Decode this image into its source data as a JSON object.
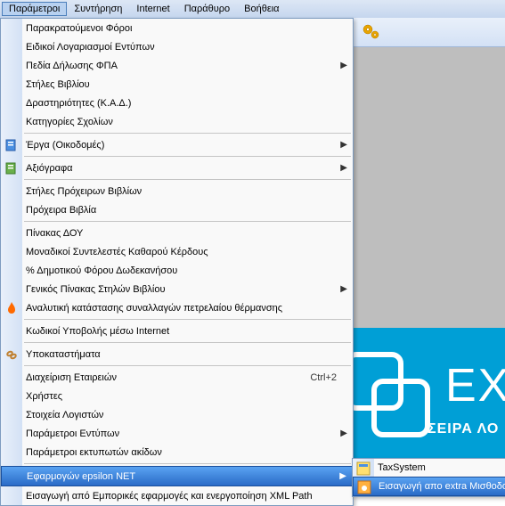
{
  "menubar": {
    "items": [
      "Παράμετροι",
      "Συντήρηση",
      "Internet",
      "Παράθυρο",
      "Βοήθεια"
    ],
    "active_index": 0
  },
  "brand": {
    "title": "EX",
    "subtitle": "ΣΕΙΡΑ ΛΟ"
  },
  "menu": {
    "groups": [
      [
        {
          "label": "Παρακρατούμενοι Φόροι"
        },
        {
          "label": "Ειδικοί Λογαριασμοί Εντύπων"
        },
        {
          "label": "Πεδία Δήλωσης ΦΠΑ",
          "sub": true
        },
        {
          "label": "Στήλες Βιβλίου"
        },
        {
          "label": "Δραστηριότητες (Κ.Α.Δ.)"
        },
        {
          "label": "Κατηγορίες Σχολίων"
        }
      ],
      [
        {
          "label": "Έργα (Οικοδομές)",
          "sub": true,
          "icon": "doc-blue"
        }
      ],
      [
        {
          "label": "Αξιόγραφα",
          "sub": true,
          "icon": "doc-green"
        }
      ],
      [
        {
          "label": "Στήλες Πρόχειρων Βιβλίων"
        },
        {
          "label": "Πρόχειρα Βιβλία"
        }
      ],
      [
        {
          "label": "Πίνακας ΔΟΥ"
        },
        {
          "label": "Μοναδικοί Συντελεστές Καθαρού Κέρδους"
        },
        {
          "label": "% Δημοτικού Φόρου Δωδεκανήσου"
        },
        {
          "label": "Γενικός Πίνακας Στηλών Βιβλίου",
          "sub": true
        },
        {
          "label": "Αναλυτική κατάστασης συναλλαγών πετρελαίου θέρμανσης",
          "icon": "flame"
        }
      ],
      [
        {
          "label": "Κωδικοί Υποβολής μέσω Internet"
        }
      ],
      [
        {
          "label": "Υποκαταστήματα",
          "icon": "chain"
        }
      ],
      [
        {
          "label": "Διαχείριση Εταιρειών",
          "shortcut": "Ctrl+2"
        },
        {
          "label": "Χρήστες"
        },
        {
          "label": "Στοιχεία Λογιστών"
        },
        {
          "label": "Παράμετροι Εντύπων",
          "sub": true
        },
        {
          "label": "Παράμετροι εκτυπωτών ακίδων"
        }
      ],
      [
        {
          "label": "Εφαρμογών epsilon NET",
          "sub": true,
          "hl": true
        },
        {
          "label": "Εισαγωγή από Εμπορικές εφαρμογές και ενεργοποίηση XML Path"
        }
      ]
    ]
  },
  "submenu": {
    "items": [
      {
        "label": "TaxSystem",
        "icon": "app-yellow"
      },
      {
        "label": "Εισαγωγή απο extra Μισθοδοσία",
        "hl": true,
        "icon": "app-orange"
      }
    ]
  }
}
